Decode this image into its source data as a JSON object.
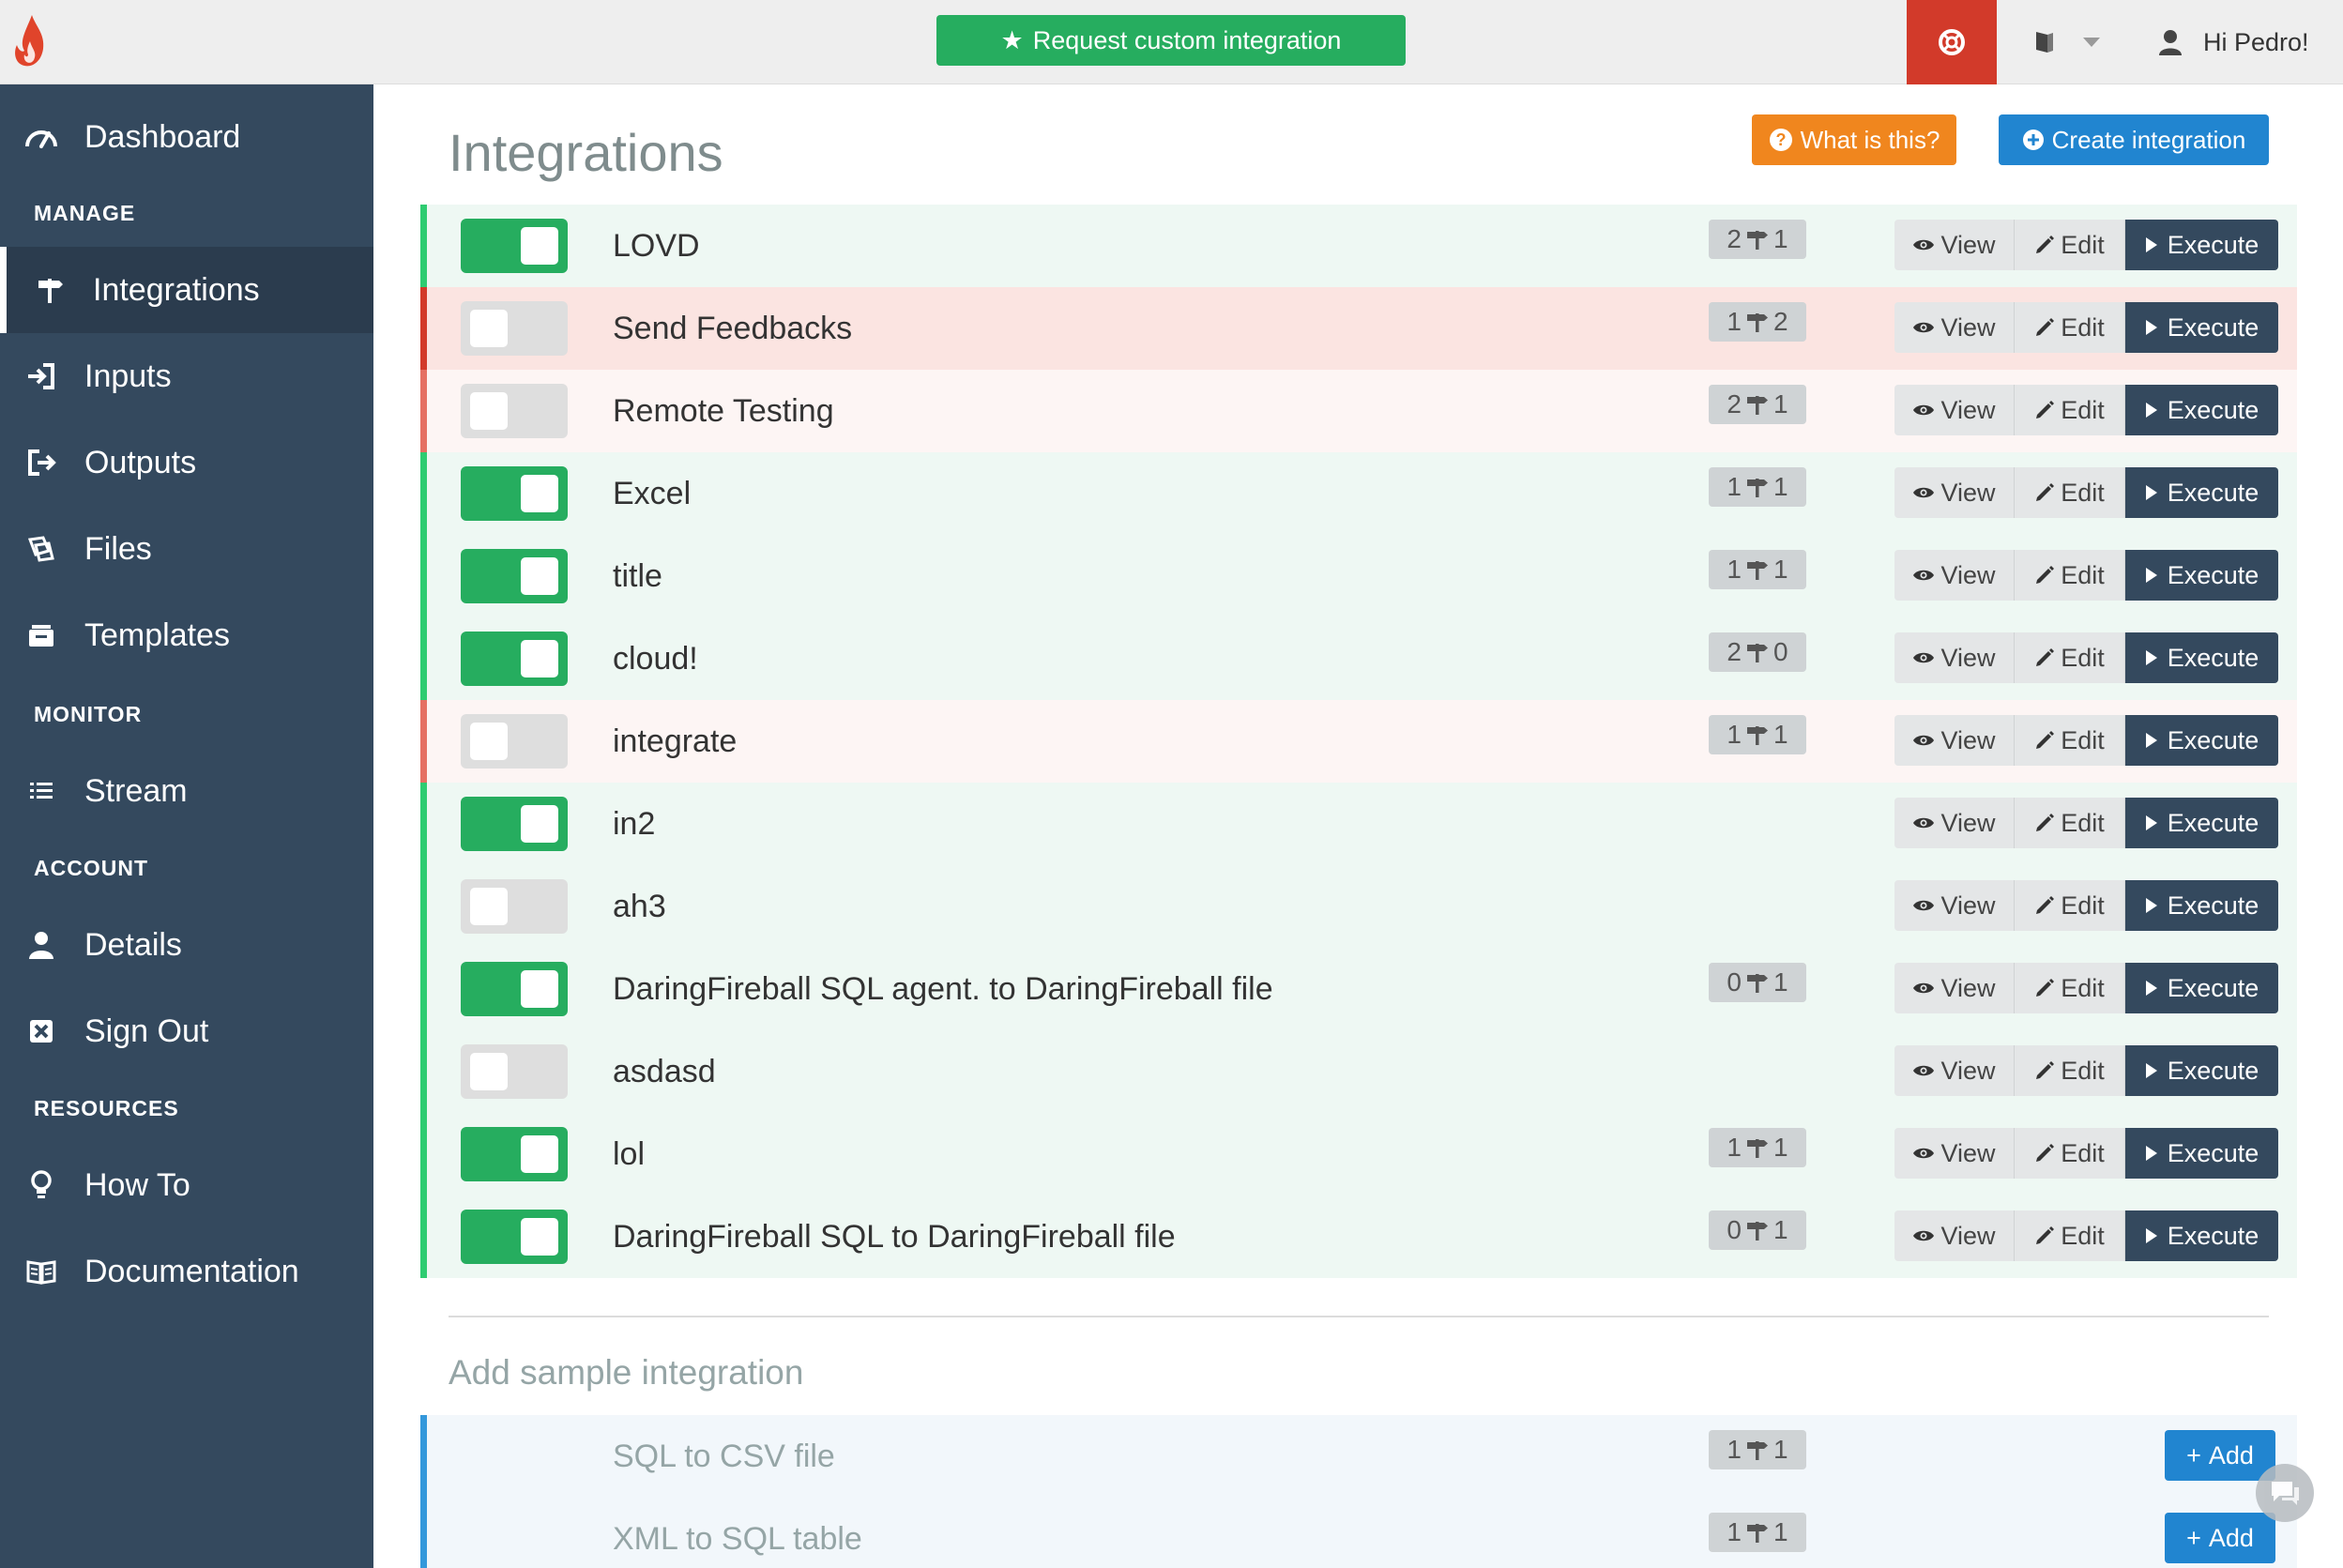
{
  "topbar": {
    "request_label": "Request custom integration",
    "greeting": "Hi Pedro!"
  },
  "sidebar": {
    "items": [
      {
        "label": "Dashboard",
        "icon": "dashboard-icon"
      },
      {
        "label": "Integrations",
        "icon": "signpost-icon"
      },
      {
        "label": "Inputs",
        "icon": "sign-in-icon"
      },
      {
        "label": "Outputs",
        "icon": "sign-out-icon"
      },
      {
        "label": "Files",
        "icon": "files-icon"
      },
      {
        "label": "Templates",
        "icon": "templates-icon"
      },
      {
        "label": "Stream",
        "icon": "list-icon"
      },
      {
        "label": "Details",
        "icon": "user-icon"
      },
      {
        "label": "Sign Out",
        "icon": "close-box-icon"
      },
      {
        "label": "How To",
        "icon": "lightbulb-icon"
      },
      {
        "label": "Documentation",
        "icon": "book-icon"
      }
    ],
    "sections": [
      "MANAGE",
      "MONITOR",
      "ACCOUNT",
      "RESOURCES"
    ],
    "active": "Integrations"
  },
  "main": {
    "title": "Integrations",
    "what_label": "What is this?",
    "create_label": "Create integration",
    "buttons": {
      "view": "View",
      "edit": "Edit",
      "execute": "Execute"
    },
    "integrations": [
      {
        "name": "LOVD",
        "enabled": true,
        "inputs": "2",
        "outputs": "1",
        "state": "on"
      },
      {
        "name": "Send Feedbacks",
        "enabled": false,
        "inputs": "1",
        "outputs": "2",
        "state": "highlight"
      },
      {
        "name": "Remote Testing",
        "enabled": false,
        "inputs": "2",
        "outputs": "1",
        "state": "off"
      },
      {
        "name": "Excel",
        "enabled": true,
        "inputs": "1",
        "outputs": "1",
        "state": "on"
      },
      {
        "name": "title",
        "enabled": true,
        "inputs": "1",
        "outputs": "1",
        "state": "on"
      },
      {
        "name": "cloud!",
        "enabled": true,
        "inputs": "2",
        "outputs": "0",
        "state": "on"
      },
      {
        "name": "integrate",
        "enabled": false,
        "inputs": "1",
        "outputs": "1",
        "state": "off"
      },
      {
        "name": "in2",
        "enabled": true,
        "inputs": null,
        "outputs": null,
        "state": "on"
      },
      {
        "name": "ah3",
        "enabled": false,
        "inputs": null,
        "outputs": null,
        "state": "on"
      },
      {
        "name": "DaringFireball SQL agent. to DaringFireball file",
        "enabled": true,
        "inputs": "0",
        "outputs": "1",
        "state": "on"
      },
      {
        "name": "asdasd",
        "enabled": false,
        "inputs": null,
        "outputs": null,
        "state": "on"
      },
      {
        "name": "lol",
        "enabled": true,
        "inputs": "1",
        "outputs": "1",
        "state": "on"
      },
      {
        "name": "DaringFireball SQL to DaringFireball file",
        "enabled": true,
        "inputs": "0",
        "outputs": "1",
        "state": "on"
      }
    ],
    "sample_title": "Add sample integration",
    "add_label": "Add",
    "samples": [
      {
        "name": "SQL to CSV file",
        "inputs": "1",
        "outputs": "1"
      },
      {
        "name": "XML to SQL table",
        "inputs": "1",
        "outputs": "1"
      }
    ]
  },
  "colors": {
    "sidebar": "#34495e",
    "success": "#26ad5f",
    "danger": "#d23a2a",
    "warning": "#f0861e",
    "primary": "#2185d0"
  }
}
